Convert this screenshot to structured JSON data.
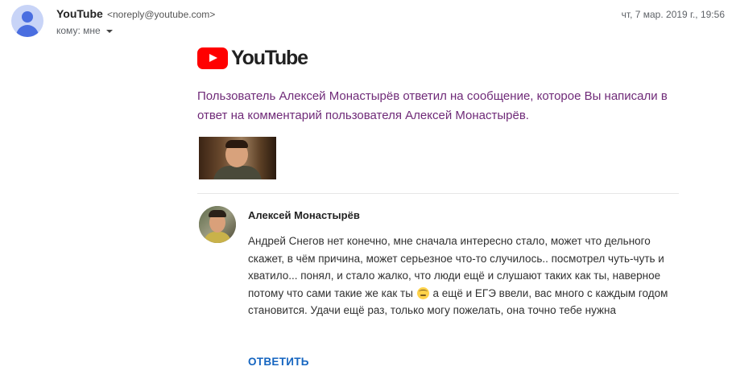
{
  "header": {
    "sender_name": "YouTube",
    "sender_email": "<noreply@youtube.com>",
    "date": "чт, 7 мар. 2019 г., 19:56",
    "to_label": "кому: мне"
  },
  "logo": {
    "wordmark": "YouTube",
    "brand_color": "#ff0000"
  },
  "intro_text": "Пользователь Алексей Монастырёв ответил на сообщение, которое Вы написали в ответ на комментарий пользователя Алексей Монастырёв.",
  "comment": {
    "author": "Алексей Монастырёв",
    "text_before_emoji": "Андрей Снегов нет конечно, мне сначала интересно стало, может что дельного скажет, в чём причина, может серьезное что-то случилось.. посмотрел чуть-чуть и хватило... понял, и стало жалко, что люди ещё и слушают таких как ты, наверное потому что сами такие же как ты",
    "emoji": "face-with-head-bandage",
    "text_after_emoji": "а ещё и ЕГЭ ввели, вас много с каждым годом становится. Удачи ещё раз, только могу пожелать, она точно тебе нужна",
    "reply_label": "ОТВЕТИТЬ"
  },
  "colors": {
    "intro_text": "#6f2a78",
    "reply_link": "#1565c0"
  }
}
